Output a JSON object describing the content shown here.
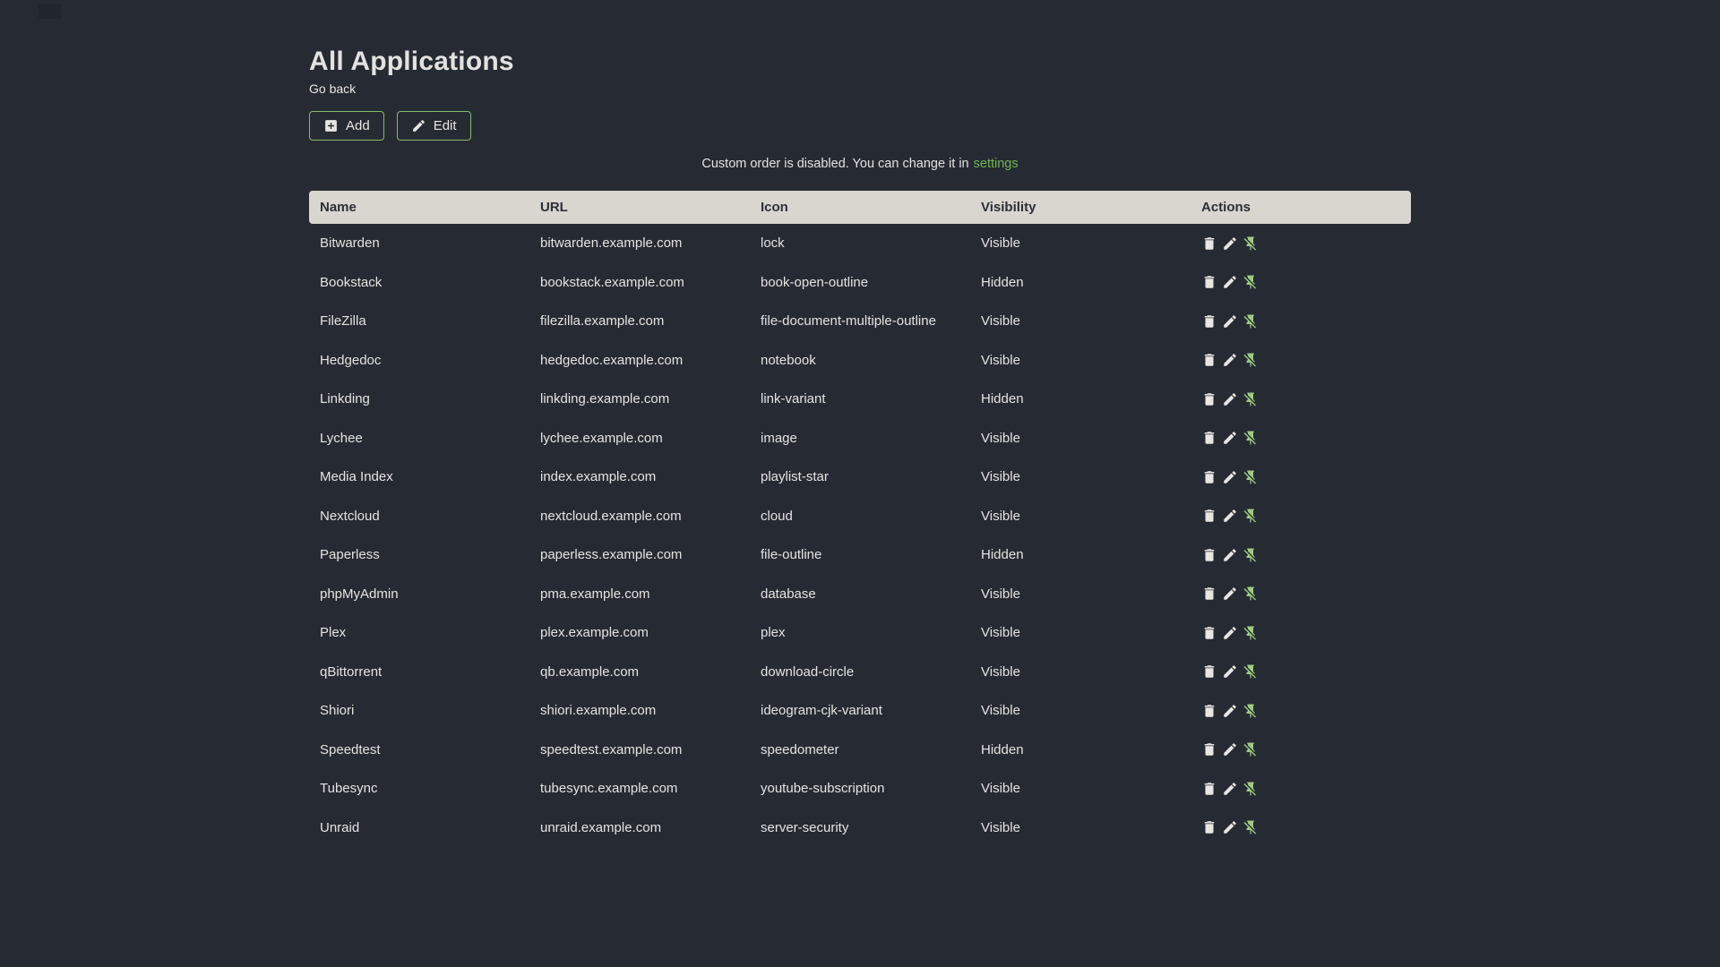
{
  "page": {
    "title": "All Applications",
    "back_label": "Go back",
    "notice_text": "Custom order is disabled. You can change it in",
    "notice_link_label": "settings"
  },
  "toolbar": {
    "add_label": "Add",
    "add_icon": "plus-box-icon",
    "edit_label": "Edit",
    "edit_icon": "pencil-icon"
  },
  "table": {
    "columns": [
      "Name",
      "URL",
      "Icon",
      "Visibility",
      "Actions"
    ],
    "row_actions": [
      {
        "name": "delete",
        "icon": "trash-icon"
      },
      {
        "name": "edit",
        "icon": "pencil-icon"
      },
      {
        "name": "unpin",
        "icon": "pin-off-icon"
      }
    ],
    "rows": [
      {
        "name": "Bitwarden",
        "url": "bitwarden.example.com",
        "icon": "lock",
        "visibility": "Visible"
      },
      {
        "name": "Bookstack",
        "url": "bookstack.example.com",
        "icon": "book-open-outline",
        "visibility": "Hidden"
      },
      {
        "name": "FileZilla",
        "url": "filezilla.example.com",
        "icon": "file-document-multiple-outline",
        "visibility": "Visible"
      },
      {
        "name": "Hedgedoc",
        "url": "hedgedoc.example.com",
        "icon": "notebook",
        "visibility": "Visible"
      },
      {
        "name": "Linkding",
        "url": "linkding.example.com",
        "icon": "link-variant",
        "visibility": "Hidden"
      },
      {
        "name": "Lychee",
        "url": "lychee.example.com",
        "icon": "image",
        "visibility": "Visible"
      },
      {
        "name": "Media Index",
        "url": "index.example.com",
        "icon": "playlist-star",
        "visibility": "Visible"
      },
      {
        "name": "Nextcloud",
        "url": "nextcloud.example.com",
        "icon": "cloud",
        "visibility": "Visible"
      },
      {
        "name": "Paperless",
        "url": "paperless.example.com",
        "icon": "file-outline",
        "visibility": "Hidden"
      },
      {
        "name": "phpMyAdmin",
        "url": "pma.example.com",
        "icon": "database",
        "visibility": "Visible"
      },
      {
        "name": "Plex",
        "url": "plex.example.com",
        "icon": "plex",
        "visibility": "Visible"
      },
      {
        "name": "qBittorrent",
        "url": "qb.example.com",
        "icon": "download-circle",
        "visibility": "Visible"
      },
      {
        "name": "Shiori",
        "url": "shiori.example.com",
        "icon": "ideogram-cjk-variant",
        "visibility": "Visible"
      },
      {
        "name": "Speedtest",
        "url": "speedtest.example.com",
        "icon": "speedometer",
        "visibility": "Hidden"
      },
      {
        "name": "Tubesync",
        "url": "tubesync.example.com",
        "icon": "youtube-subscription",
        "visibility": "Visible"
      },
      {
        "name": "Unraid",
        "url": "unraid.example.com",
        "icon": "server-security",
        "visibility": "Visible"
      }
    ]
  },
  "colors": {
    "bg": "#262b33",
    "text": "#e8e6e3",
    "accent_green": "#71b34f",
    "button_border": "#84bd63",
    "pin_green": "#9dcb83",
    "header_bg": "#d9d5cf",
    "header_text": "#2b2f38"
  }
}
